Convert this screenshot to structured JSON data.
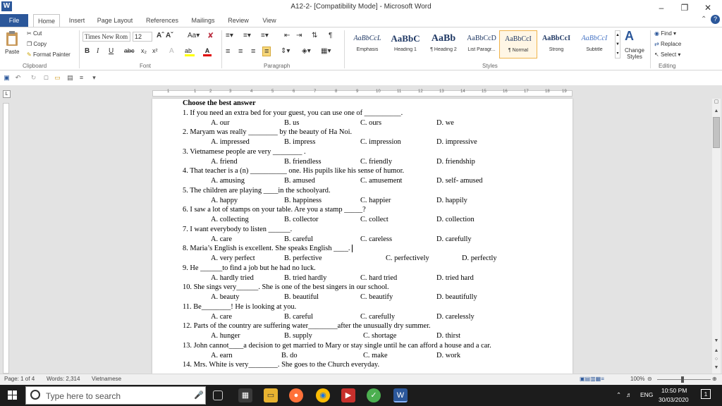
{
  "window": {
    "title": "A12-2- [Compatibility Mode] - Microsoft Word",
    "app_icon": "W"
  },
  "tabs": [
    "File",
    "Home",
    "Insert",
    "Page Layout",
    "References",
    "Mailings",
    "Review",
    "View"
  ],
  "ribbon": {
    "clipboard": {
      "paste": "Paste",
      "cut": "Cut",
      "copy": "Copy",
      "format_painter": "Format Painter",
      "label": "Clipboard"
    },
    "font": {
      "name": "Times New Rom",
      "size": "12",
      "label": "Font"
    },
    "paragraph": {
      "label": "Paragraph"
    },
    "styles": {
      "label": "Styles",
      "items": [
        {
          "preview": "AaBbCcL",
          "name": "Emphasis"
        },
        {
          "preview": "AaBbC",
          "name": "Heading 1"
        },
        {
          "preview": "AaBb",
          "name": "¶ Heading 2"
        },
        {
          "preview": "AaBbCcD",
          "name": "List Paragr..."
        },
        {
          "preview": "AaBbCcI",
          "name": "¶ Normal"
        },
        {
          "preview": "AaBbCcI",
          "name": "Strong"
        },
        {
          "preview": "AaBbCcI",
          "name": "Subtitle"
        }
      ],
      "change_styles": "Change Styles"
    },
    "editing": {
      "find": "Find",
      "replace": "Replace",
      "select": "Select",
      "label": "Editing"
    }
  },
  "document": {
    "heading": "Choose the best answer",
    "questions": [
      {
        "q": "1. If you need an extra bed for your guest, you can use one of __________.",
        "opts": [
          "A. our",
          "B. us",
          "C. ours",
          "D. we"
        ]
      },
      {
        "q": "2. Maryam was really ________ by the beauty of Ha Noi.",
        "opts": [
          "A. impressed",
          "B. impress",
          "C. impression",
          "D. impressive"
        ]
      },
      {
        "q": "3. Vietnamese people are very ________ .",
        "opts": [
          "A. friend",
          "B. friendless",
          "C. friendly",
          "D. friendship"
        ]
      },
      {
        "q": "4. That teacher is a (n) __________ one. His pupils like his sense of humor.",
        "opts": [
          "A. amusing",
          "B. amused",
          "C. amusement",
          "D. self- amused"
        ]
      },
      {
        "q": "5. The children are playing ____in the schoolyard.",
        "opts": [
          "A. happy",
          "B. happiness",
          "C. happier",
          "D. happily"
        ]
      },
      {
        "q": "6.  I saw a lot of stamps on your table. Are you a stamp _____?",
        "opts": [
          "A. collecting",
          "B. collector",
          "C. collect",
          "D. collection"
        ]
      },
      {
        "q": "7. I want everybody to listen ______.",
        "opts": [
          "A. care",
          "B. careful",
          "C. careless",
          "D. carefully"
        ]
      },
      {
        "q": "8. Maria’s English is excellent. She speaks English ____.",
        "opts": [
          "A. very perfect",
          "B. perfective",
          "C. perfectively",
          "D. perfectly"
        ]
      },
      {
        "q": "9. He ______to find a job but he had no luck.",
        "opts": [
          "A. hardly tried",
          "B. tried hardly",
          "C. hard tried",
          "D. tried hard"
        ]
      },
      {
        "q": "10. She sings very______. She is one of the best singers in our school.",
        "opts": [
          "A. beauty",
          "B. beautiful",
          "C. beautify",
          "D. beautifully"
        ]
      },
      {
        "q": "11. Be________! He is looking at you.",
        "opts": [
          "A. care",
          "B. careful",
          "C. carefully",
          "D. carelessly"
        ]
      },
      {
        "q": "12. Parts of the country are suffering water________after the unusually dry summer.",
        "opts": [
          "A. hunger",
          "B. supply",
          "C. shortage",
          "D. thirst"
        ]
      },
      {
        "q": "13. John cannot____a decision to get married to Mary or stay single until he can afford a house and a car.",
        "opts": [
          "A. earn",
          "B. do",
          "C. make",
          "D. work"
        ]
      },
      {
        "q": "14. Mrs. White is very________. She goes to the Church everyday.",
        "opts": []
      }
    ]
  },
  "statusbar": {
    "page": "Page: 1 of 4",
    "words": "Words: 2,314",
    "language": "Vietnamese",
    "zoom": "100%"
  },
  "taskbar": {
    "search_placeholder": "Type here to search",
    "lang": "ENG",
    "time": "10:50 PM",
    "date": "30/03/2020",
    "notification_count": "1"
  }
}
